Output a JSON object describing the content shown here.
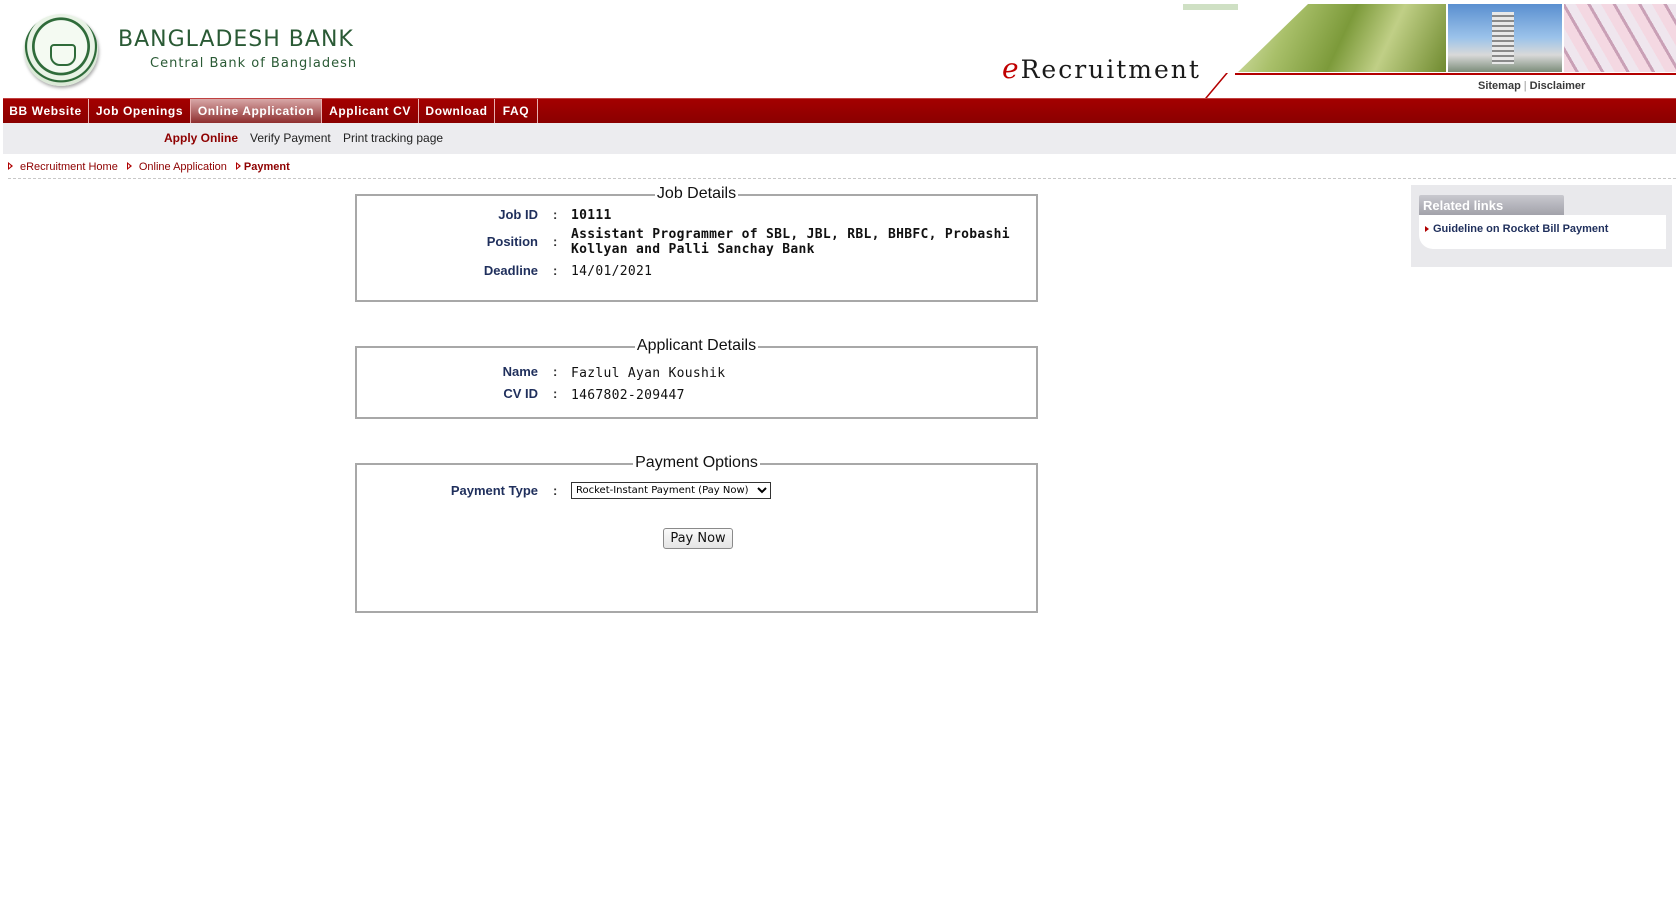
{
  "header": {
    "bank_name": "BANGLADESH BANK",
    "bank_subtitle": "Central Bank of Bangladesh",
    "erec_prefix": "e",
    "erec_title": "Recruitment",
    "sitemap": "Sitemap",
    "separator": "|",
    "disclaimer": "Disclaimer"
  },
  "nav": {
    "items": [
      "BB Website",
      "Job Openings",
      "Online Application",
      "Applicant CV",
      "Download",
      "FAQ"
    ],
    "active_index": 2
  },
  "subnav": {
    "items": [
      "Apply Online",
      "Verify Payment",
      "Print tracking page"
    ],
    "active_index": 0
  },
  "breadcrumb": {
    "items": [
      "eRecruitment Home",
      "Online Application",
      "Payment"
    ]
  },
  "job_details": {
    "legend": "Job Details",
    "job_id_label": "Job ID",
    "job_id": "10111",
    "position_label": "Position",
    "position": "Assistant Programmer of SBL, JBL, RBL, BHBFC, Probashi Kollyan and Palli Sanchay Bank",
    "deadline_label": "Deadline",
    "deadline": "14/01/2021",
    "colon": ":"
  },
  "applicant_details": {
    "legend": "Applicant Details",
    "name_label": "Name",
    "name": "Fazlul Ayan Koushik",
    "cv_id_label": "CV ID",
    "cv_id": "1467802-209447",
    "colon": ":"
  },
  "payment_options": {
    "legend": "Payment Options",
    "type_label": "Payment Type",
    "selected_type": "Rocket-Instant Payment (Pay Now)",
    "pay_button": "Pay Now",
    "colon": ":"
  },
  "related_links": {
    "title": "Related links",
    "items": [
      "Guideline on Rocket Bill Payment"
    ]
  },
  "colors": {
    "nav_red": "#a40000",
    "link_red": "#8e0000",
    "label_navy": "#1f2f5c",
    "logo_green": "#2a5a35"
  }
}
